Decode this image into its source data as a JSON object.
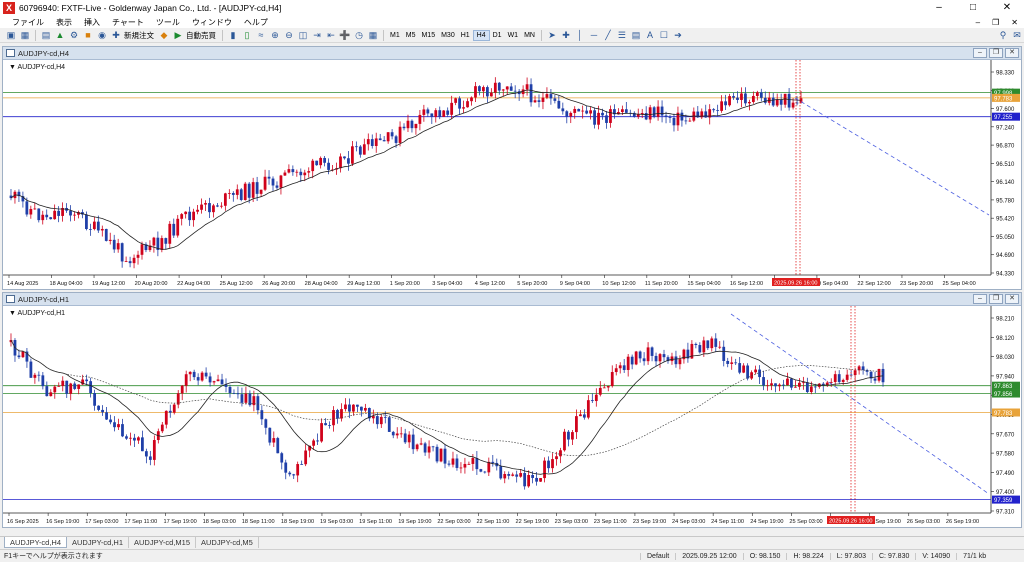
{
  "window": {
    "title": "60796940: FXTF-Live - Goldenway Japan Co., Ltd. - [AUDJPY-cd,H4]",
    "app_icon": "X"
  },
  "menu": [
    "ファイル",
    "表示",
    "挿入",
    "チャート",
    "ツール",
    "ウィンドウ",
    "ヘルプ"
  ],
  "toolbar": {
    "new_order_label": "新規注文",
    "auto_trade_label": "自動売買",
    "timeframes": [
      "M1",
      "M5",
      "M15",
      "M30",
      "H1",
      "H4",
      "D1",
      "W1",
      "MN"
    ],
    "active_timeframe": "H4"
  },
  "charts": [
    {
      "title": "AUDJPY-cd,H4",
      "label": "AUDJPY-cd,H4",
      "price_labels": [
        "98.330",
        "97.960",
        "97.600",
        "97.240",
        "96.870",
        "96.510",
        "96.140",
        "95.780",
        "95.420",
        "95.050",
        "94.690",
        "94.330"
      ],
      "price_min": 94.33,
      "price_max": 98.33,
      "markers": [
        {
          "value": "97.998",
          "price": 97.82,
          "color": "#2e8b2e"
        },
        {
          "value": "97.783",
          "price": 97.72,
          "color": "#e8a33a"
        },
        {
          "value": "97.255",
          "price": 97.36,
          "color": "#2222cc"
        }
      ],
      "time_labels": [
        "14 Aug 2025",
        "18 Aug 04:00",
        "19 Aug 12:00",
        "20 Aug 20:00",
        "22 Aug 04:00",
        "25 Aug 12:00",
        "26 Aug 20:00",
        "28 Aug 04:00",
        "29 Aug 12:00",
        "1 Sep 20:00",
        "3 Sep 04:00",
        "4 Sep 12:00",
        "5 Sep 20:00",
        "9 Sep 04:00",
        "10 Sep 12:00",
        "11 Sep 20:00",
        "15 Sep 04:00",
        "16 Sep 12:00",
        "17 Sep 20:00",
        "19 Sep 04:00",
        "22 Sep 12:00",
        "23 Sep 20:00",
        "25 Sep 04:00"
      ],
      "time_marker": "2025.09.26 16:00",
      "seed": 11
    },
    {
      "title": "AUDJPY-cd,H1",
      "label": "AUDJPY-cd,H1",
      "price_labels": [
        "98.210",
        "98.120",
        "98.030",
        "97.940",
        "97.850",
        "97.760",
        "97.670",
        "97.580",
        "97.490",
        "97.400",
        "97.310"
      ],
      "price_min": 97.31,
      "price_max": 98.21,
      "markers": [
        {
          "value": "97.863",
          "price": 97.88,
          "color": "#2e8b2e"
        },
        {
          "value": "97.856",
          "price": 97.845,
          "color": "#2e8b2e"
        },
        {
          "value": "97.783",
          "price": 97.76,
          "color": "#e8a33a"
        },
        {
          "value": "97.359",
          "price": 97.37,
          "color": "#2222cc"
        }
      ],
      "time_labels": [
        "16 Sep 2025",
        "16 Sep 19:00",
        "17 Sep 03:00",
        "17 Sep 11:00",
        "17 Sep 19:00",
        "18 Sep 03:00",
        "18 Sep 11:00",
        "18 Sep 19:00",
        "19 Sep 03:00",
        "19 Sep 11:00",
        "19 Sep 19:00",
        "22 Sep 03:00",
        "22 Sep 11:00",
        "22 Sep 19:00",
        "23 Sep 03:00",
        "23 Sep 11:00",
        "23 Sep 19:00",
        "24 Sep 03:00",
        "24 Sep 11:00",
        "24 Sep 19:00",
        "25 Sep 03:00",
        "25 Sep 11:00",
        "25 Sep 19:00",
        "26 Sep 03:00",
        "26 Sep 19:00"
      ],
      "time_marker": "2025.09.26 16:00",
      "seed": 29
    }
  ],
  "tabs": [
    "AUDJPY-cd,H4",
    "AUDJPY-cd,H1",
    "AUDJPY-cd,M15",
    "AUDJPY-cd,M5"
  ],
  "active_tab": "AUDJPY-cd,H4",
  "status": {
    "help": "F1キーでヘルプが表示されます",
    "profile": "Default",
    "datetime": "2025.09.25 12:00",
    "open": "O: 98.150",
    "high": "H: 98.224",
    "low": "L: 97.803",
    "close": "C: 97.830",
    "volume": "V: 14090",
    "traffic": "71/1 kb"
  }
}
